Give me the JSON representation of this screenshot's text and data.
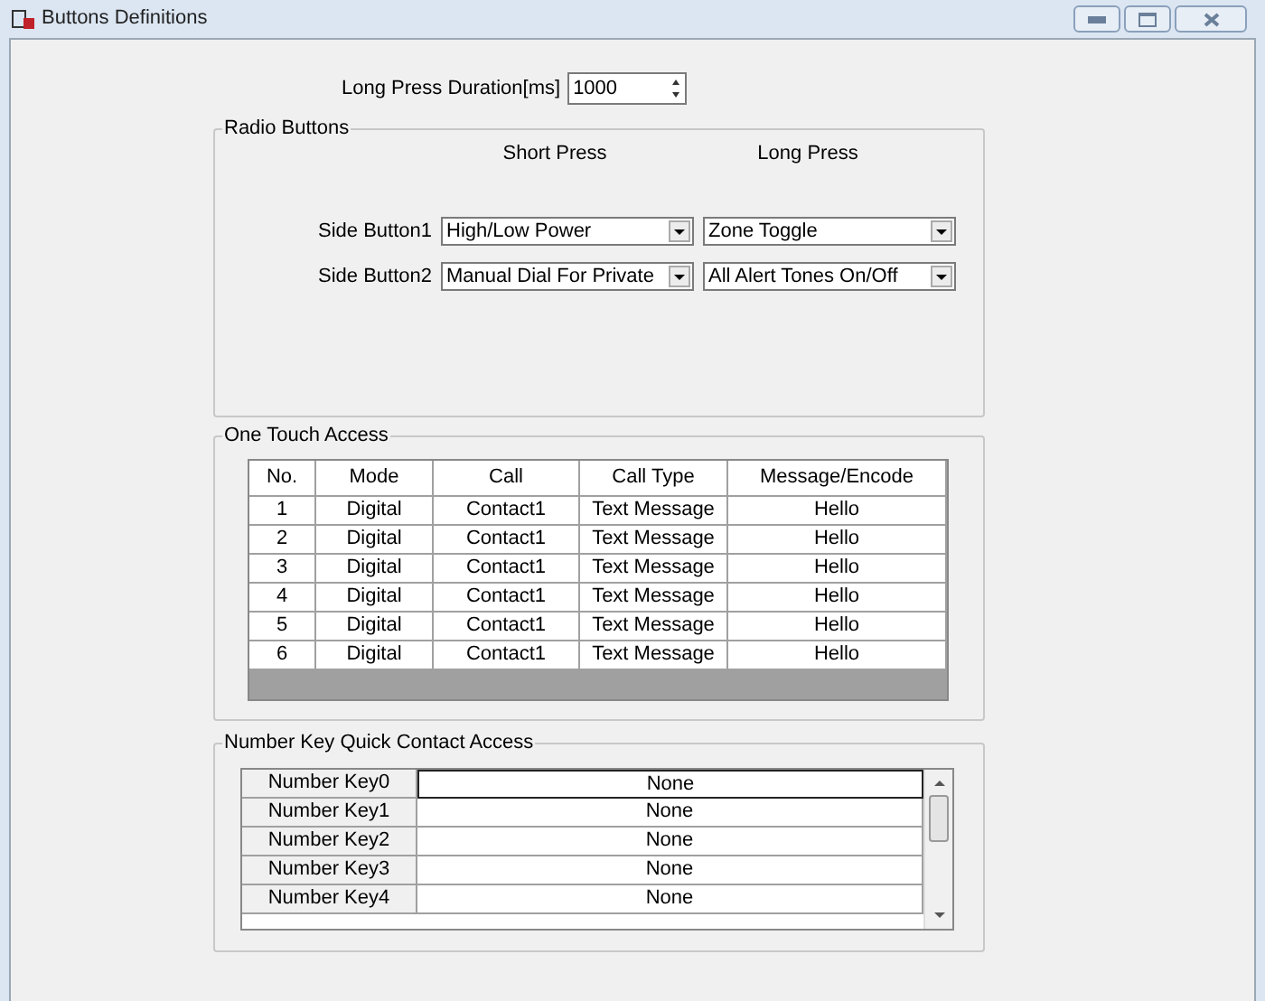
{
  "window": {
    "title": "Buttons Definitions"
  },
  "long_press_duration": {
    "label": "Long Press Duration[ms]",
    "value": "1000"
  },
  "radio_buttons": {
    "title": "Radio Buttons",
    "column_headers": [
      "Short Press",
      "Long Press"
    ],
    "rows": [
      {
        "label": "Side Button1",
        "short_press": "High/Low Power",
        "long_press": "Zone Toggle"
      },
      {
        "label": "Side Button2",
        "short_press": "Manual Dial For Private",
        "long_press": "All Alert Tones On/Off"
      }
    ]
  },
  "one_touch_access": {
    "title": "One Touch Access",
    "columns": [
      "No.",
      "Mode",
      "Call",
      "Call Type",
      "Message/Encode"
    ],
    "rows": [
      [
        "1",
        "Digital",
        "Contact1",
        "Text Message",
        "Hello"
      ],
      [
        "2",
        "Digital",
        "Contact1",
        "Text Message",
        "Hello"
      ],
      [
        "3",
        "Digital",
        "Contact1",
        "Text Message",
        "Hello"
      ],
      [
        "4",
        "Digital",
        "Contact1",
        "Text Message",
        "Hello"
      ],
      [
        "5",
        "Digital",
        "Contact1",
        "Text Message",
        "Hello"
      ],
      [
        "6",
        "Digital",
        "Contact1",
        "Text Message",
        "Hello"
      ]
    ]
  },
  "number_key_access": {
    "title": "Number Key Quick Contact Access",
    "rows": [
      {
        "key": "Number Key0",
        "value": "None",
        "selected": true
      },
      {
        "key": "Number Key1",
        "value": "None",
        "selected": false
      },
      {
        "key": "Number Key2",
        "value": "None",
        "selected": false
      },
      {
        "key": "Number Key3",
        "value": "None",
        "selected": false
      },
      {
        "key": "Number Key4",
        "value": "None",
        "selected": false
      }
    ]
  }
}
